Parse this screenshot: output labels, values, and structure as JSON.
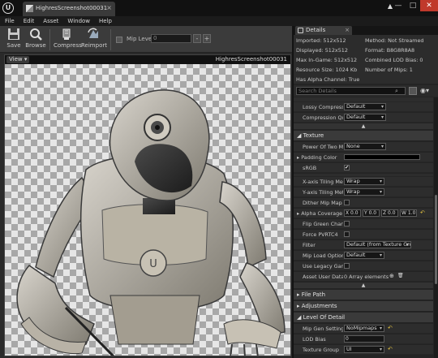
{
  "window": {
    "tab_title": "HighresScreenshot00031",
    "tab_close": "×",
    "minimize": "—",
    "maximize": "□",
    "close": "✕",
    "notification": "▲"
  },
  "menu": [
    "File",
    "Edit",
    "Asset",
    "Window",
    "Help"
  ],
  "toolbar": {
    "save_label": "Save",
    "browse_label": "Browse",
    "compress_label": "Compress",
    "reimport_label": "Reimport",
    "mip_level_label": "Mip Level:",
    "mip_level_value": "0",
    "mip_minus": "-",
    "mip_plus": "+"
  },
  "viewport": {
    "view_button": "View ▾",
    "title": "HighresScreenshot00031"
  },
  "details": {
    "tab_label": "Details",
    "tab_close": "×",
    "info": {
      "imported": "Imported: 512x512",
      "displayed": "Displayed: 512x512",
      "max_in_game": "Max In-Game: 512x512",
      "resource_size": "Resource Size: 1024 Kb",
      "has_alpha": "Has Alpha Channel: True",
      "method": "Method: Not Streamed",
      "format": "Format: B8G8R8A8",
      "combined_lod": "Combined LOD Bias: 0",
      "num_mips": "Number of Mips: 1"
    },
    "search_placeholder": "Search Details",
    "search_icon": "⌕",
    "eye_icon": "◉▾",
    "rows_top": {
      "lossy_label": "Lossy Compressio",
      "lossy_value": "Default",
      "quality_label": "Compression Quali",
      "quality_value": "Default",
      "adv_arrow": "▲"
    },
    "texture": {
      "header": "◢ Texture",
      "power_of_two_label": "Power Of Two Mod",
      "power_of_two_value": "None",
      "padding_label": "▸ Padding Color",
      "srgb_label": "sRGB",
      "srgb_check": "✔",
      "x_tiling_label": "X-axis Tiling Metho",
      "x_tiling_value": "Wrap",
      "y_tiling_label": "Y-axis Tiling Metho",
      "y_tiling_value": "Wrap",
      "dither_label": "Dither Mip Map Alp",
      "alpha_cov_label": "▸ Alpha Coverage Th",
      "alpha_x": "X  0.0",
      "alpha_y": "Y  0.0",
      "alpha_z": "Z  0.0",
      "alpha_w": "W  1.0",
      "flip_green_label": "Flip Green Channel",
      "force_pvrtc_label": "Force PVRTC4",
      "filter_label": "Filter",
      "filter_value": "Default (from Texture Group)",
      "mip_load_label": "Mip Load Options",
      "mip_load_value": "Default",
      "legacy_gamma_label": "Use Legacy Gamm",
      "asset_user_label": "Asset User Data",
      "asset_user_value": "0 Array elements",
      "add_icon": "⊕",
      "delete_icon": "🗑",
      "adv_arrow": "▲",
      "reset_icon": "↶"
    },
    "file_path_header": "▸ File Path",
    "adjustments_header": "▸ Adjustments",
    "lod": {
      "header": "◢ Level Of Detail",
      "mip_gen_label": "Mip Gen Settings",
      "mip_gen_value": "NoMipmaps",
      "lod_bias_label": "LOD Bias",
      "lod_bias_value": "0",
      "texture_group_label": "Texture Group",
      "texture_group_value": "UI",
      "reset_icon": "↶"
    }
  }
}
